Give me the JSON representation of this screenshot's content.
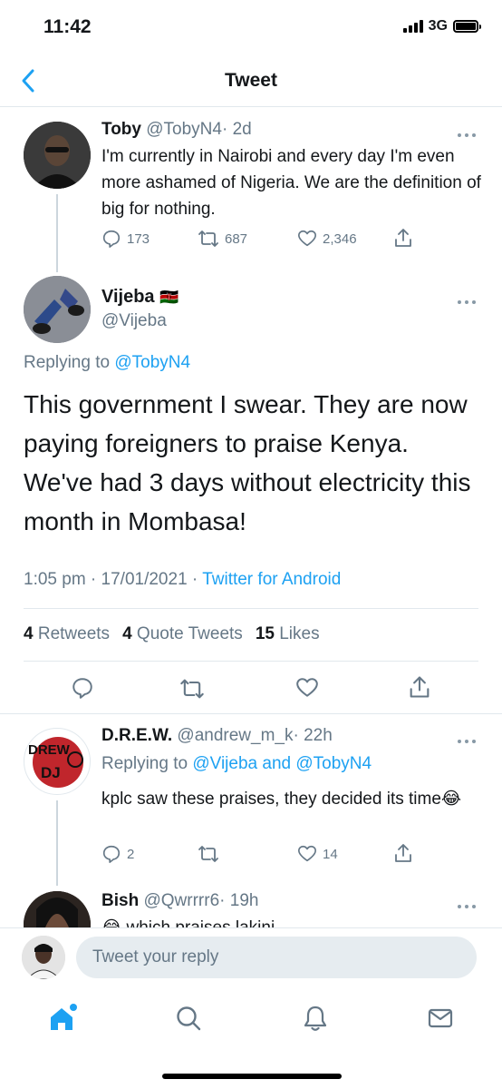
{
  "status": {
    "time": "11:42",
    "network": "3G"
  },
  "nav": {
    "title": "Tweet"
  },
  "parent_tweet": {
    "name": "Toby",
    "handle": "@TobyN4",
    "time": "· 2d",
    "text": "I'm currently in Nairobi and every day I'm even more ashamed of Nigeria. We are the definition of big for nothing.",
    "replies": "173",
    "retweets": "687",
    "likes": "2,346"
  },
  "main_tweet": {
    "name": "Vijeba",
    "flag": "🇰🇪",
    "handle": "@Vijeba",
    "replying_prefix": "Replying to",
    "replying_to": "@TobyN4",
    "text": "This government I swear. They are now paying foreigners to praise Kenya. We've had 3 days without electricity this month in Mombasa!",
    "time": "1:05 pm · 17/01/2021 ·",
    "source": "Twitter for Android",
    "retweets_count": "4",
    "retweets_label": "Retweets",
    "quotes_count": "4",
    "quotes_label": "Quote Tweets",
    "likes_count": "15",
    "likes_label": "Likes"
  },
  "reply_1": {
    "name": "D.R.E.W.",
    "handle": "@andrew_m_k",
    "time": "· 22h",
    "replying_prefix": "Replying to",
    "replying_to": "@Vijeba and @TobyN4",
    "text": "kplc saw these praises, they decided its time",
    "emoji": "😂",
    "replies": "2",
    "likes": "14",
    "avatar_text_1": "DREW",
    "avatar_text_2": "DJ"
  },
  "reply_2": {
    "name": "Bish",
    "handle": "@Qwrrrr6",
    "time": "· 19h",
    "text": "😂 which praises lakini"
  },
  "composer": {
    "placeholder": "Tweet your reply"
  },
  "colors": {
    "accent": "#1da1f2",
    "muted": "#657786",
    "border": "#e1e8ed"
  }
}
